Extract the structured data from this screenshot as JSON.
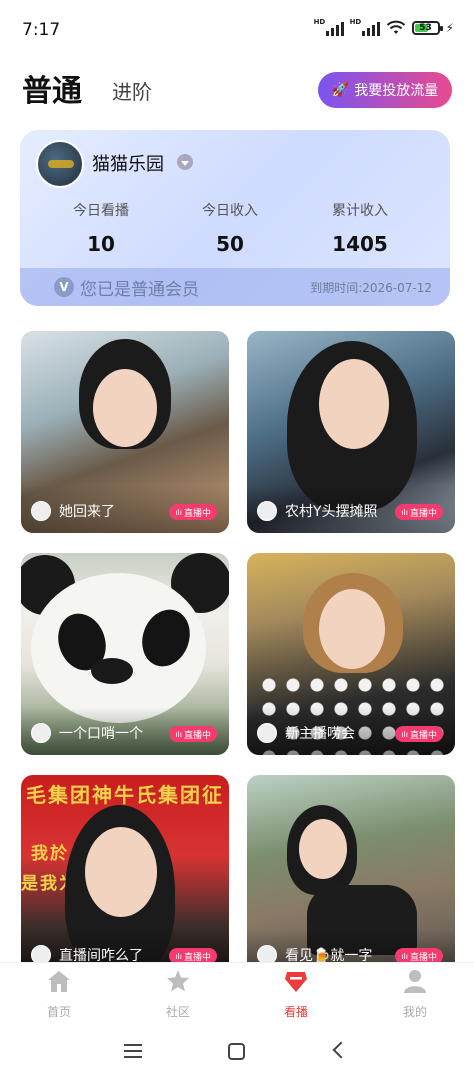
{
  "status": {
    "time": "7:17",
    "signal_1": "HD",
    "signal_2": "HD",
    "battery": "53"
  },
  "header": {
    "tab_normal": "普通",
    "tab_advanced": "进阶",
    "boost_button": "我要投放流量"
  },
  "member": {
    "name": "猫猫乐园",
    "stats": [
      {
        "label": "今日看播",
        "value": "10"
      },
      {
        "label": "今日收入",
        "value": "50"
      },
      {
        "label": "累计收入",
        "value": "1405"
      }
    ],
    "vip_text": "您已是普通会员",
    "expire_text": "到期时间:2026-07-12"
  },
  "live": {
    "badge": "直播中",
    "items": [
      {
        "title": "她回来了"
      },
      {
        "title": "农村Y头摆摊照"
      },
      {
        "title": "一个口哨一个"
      },
      {
        "title": "新主播唠会"
      },
      {
        "title": "直播间咋么了"
      },
      {
        "title": "看见🍺就一字"
      }
    ],
    "banner_line_1": "毛集团神牛氏集团征",
    "banner_line_2": "我於      打服",
    "banner_line_3": "是我为      男神"
  },
  "tabbar": {
    "items": [
      {
        "label": "首页",
        "icon": "home-icon",
        "active": false
      },
      {
        "label": "社区",
        "icon": "star-icon",
        "active": false
      },
      {
        "label": "看播",
        "icon": "diamond-icon",
        "active": true
      },
      {
        "label": "我的",
        "icon": "person-icon",
        "active": false
      }
    ]
  },
  "colors": {
    "accent": "#ee3b3b",
    "live_badge": "#f43b6f",
    "boost_start": "#7a55f0",
    "boost_end": "#e84a8e"
  }
}
